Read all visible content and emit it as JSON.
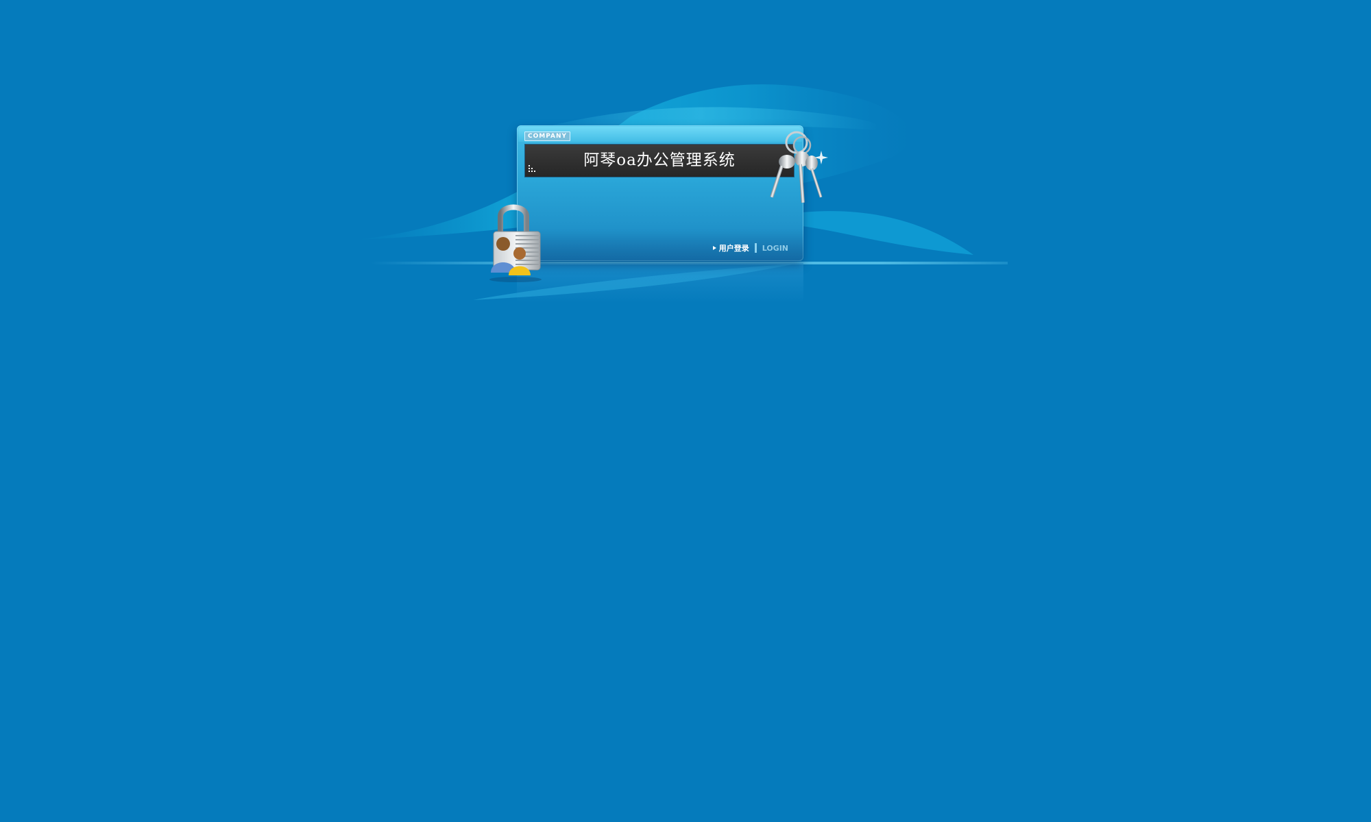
{
  "login_panel": {
    "company_badge": "COMPANY",
    "title": "阿琴oa办公管理系统",
    "nav": {
      "login_cn": "用户登录",
      "login_en": "LOGIN"
    }
  },
  "icons": {
    "lock": "padlock-with-users-icon",
    "keys": "key-ring-icon",
    "arrow": "triangle-right-icon"
  },
  "colors": {
    "background": "#057bbc",
    "panel": "#2aa6d8",
    "title_bar": "#2f2f2f"
  }
}
